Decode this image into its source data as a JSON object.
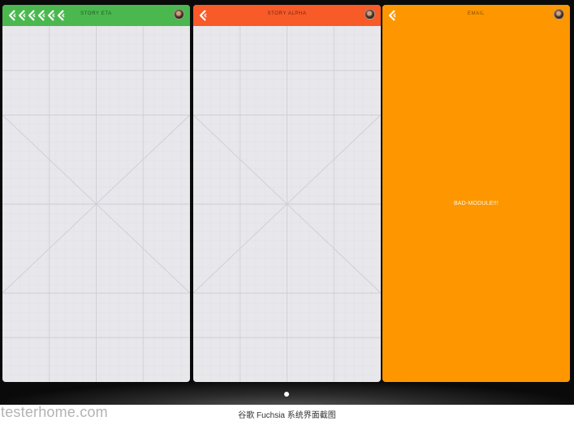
{
  "cards": [
    {
      "title": "STORY ETA",
      "back_icon_count": 6,
      "header_color": "#4ab84e",
      "body": "wireframe-placeholder"
    },
    {
      "title": "STORY ALPHA",
      "back_icon_count": 1,
      "header_color": "#f85a28",
      "body": "wireframe-placeholder"
    },
    {
      "title": "EMAIL",
      "back_icon_count": 1,
      "header_color": "#fe9600",
      "body_text": "BAD-MODULE!!!"
    }
  ],
  "icons": {
    "back": "flutter-back-chevron-icon",
    "avatar": "user-avatar"
  },
  "pager": {
    "dots": 1
  },
  "watermark": "testerhome.com",
  "caption": "谷歌 Fuchsia 系统界面截图"
}
